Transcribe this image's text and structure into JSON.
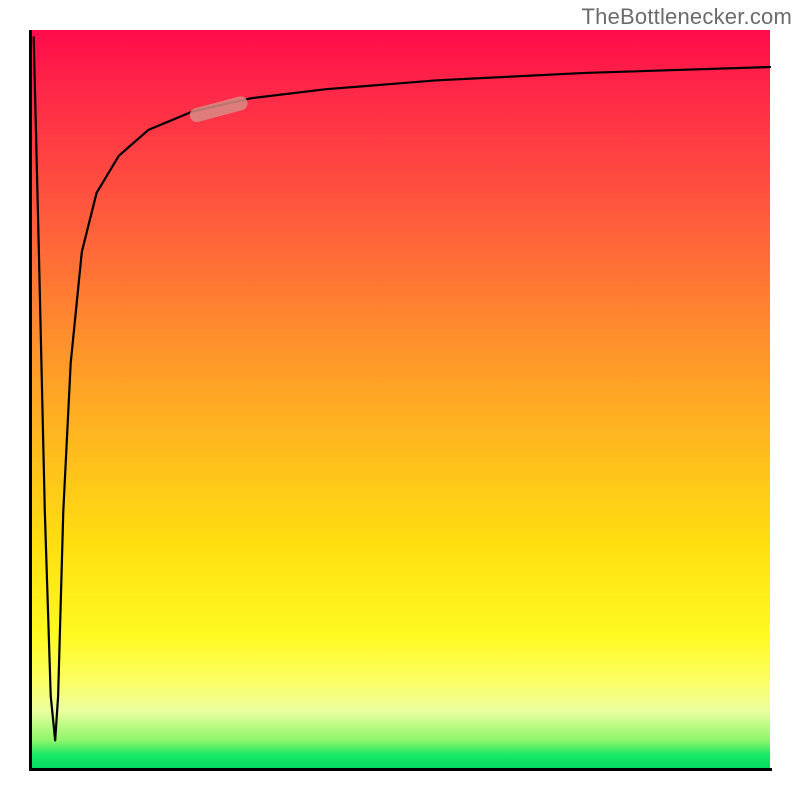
{
  "attribution": "TheBottlenecker.com",
  "colors": {
    "gradient_top": "#ff0a4a",
    "gradient_mid_orange": "#ff8a2e",
    "gradient_mid_yellow": "#ffe010",
    "gradient_bottom_green": "#00d85f",
    "curve": "#000000",
    "marker": "#d88b85",
    "axis": "#000000"
  },
  "chart_data": {
    "type": "line",
    "title": "",
    "xlabel": "",
    "ylabel": "",
    "xlim": [
      0,
      100
    ],
    "ylim": [
      0,
      100
    ],
    "axes_labeled": false,
    "grid": false,
    "notes": "Axes carry no tick labels in the source image; x/y values are proportional positions read from pixel geometry, normalized to 0–100. Curve dives from top-left to near the bottom at x≈3 then rises steeply and asymptotes toward y≈95 at the right edge.",
    "series": [
      {
        "name": "curve",
        "x": [
          0.5,
          1.2,
          2.0,
          2.8,
          3.4,
          3.8,
          4.5,
          5.5,
          7.0,
          9.0,
          12.0,
          16.0,
          22.0,
          30.0,
          40.0,
          55.0,
          75.0,
          100.0
        ],
        "y": [
          99.0,
          70.0,
          35.0,
          10.0,
          4.0,
          10.0,
          35.0,
          55.0,
          70.0,
          78.0,
          83.0,
          86.5,
          89.0,
          90.8,
          92.0,
          93.2,
          94.2,
          95.0
        ]
      }
    ],
    "marker": {
      "note": "Short thick pale segment highlighted on the curve near the upper-left ascent.",
      "x": 25.5,
      "y": 89.3,
      "length_pct": 8,
      "angle_deg": 15
    }
  }
}
